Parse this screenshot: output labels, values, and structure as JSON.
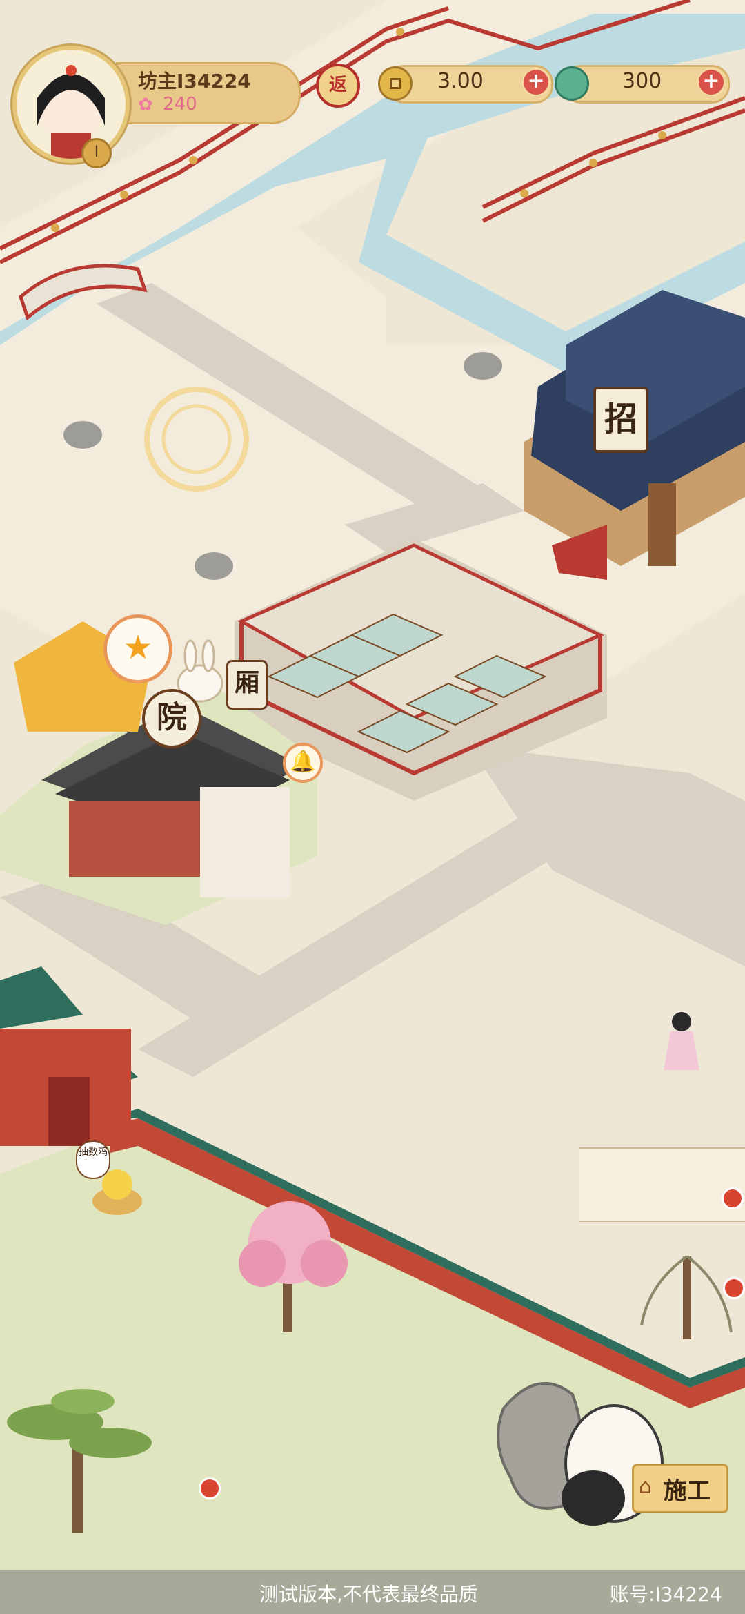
{
  "player": {
    "name": "坊主I34224",
    "reputation": "240",
    "level": "I"
  },
  "hud": {
    "return_label": "返",
    "coins": "3.00",
    "jade": "300",
    "plus": "+"
  },
  "buildings": {
    "courtyard_sign": "院",
    "wing_sign": "厢",
    "recruit_sign": "招",
    "chick_sign": "抽数鸡",
    "star_icon": "★",
    "bell_icon": "🔔"
  },
  "actions": {
    "build_label": "施工",
    "build_icon": "⌂"
  },
  "footer": {
    "notice": "测试版本,不代表最终品质",
    "account": "账号:I34224"
  },
  "colors": {
    "ground": "#efe7d6",
    "water": "#bcdce1",
    "railing": "#b83a32",
    "wall": "#c14936",
    "roof_teal": "#2f6d5c",
    "roof_navy": "#2e3f5f",
    "grass": "#dfe6bf",
    "accent_gold": "#e6c77a"
  }
}
